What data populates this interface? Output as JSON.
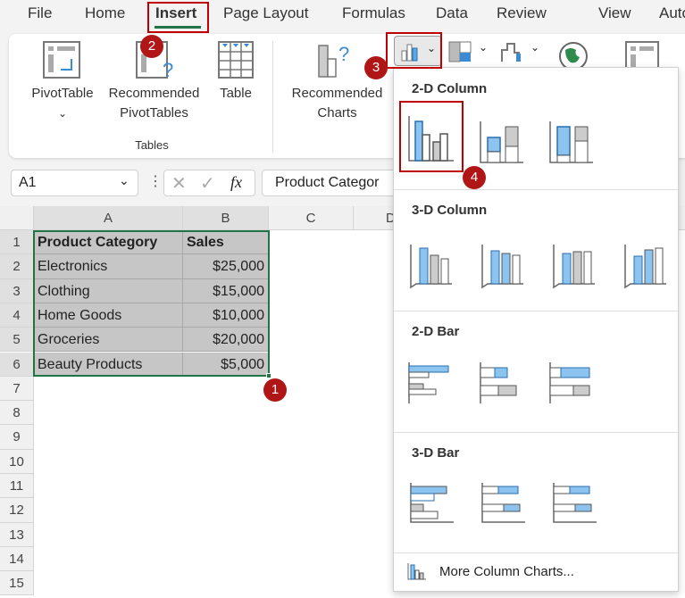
{
  "menu_tabs": [
    "File",
    "Home",
    "Insert",
    "Page Layout",
    "Formulas",
    "Data",
    "Review",
    "View",
    "Autom"
  ],
  "active_tab": "Insert",
  "ribbon": {
    "pivottable": "PivotTable",
    "rec_pivot_1": "Recommended",
    "rec_pivot_2": "PivotTables",
    "table": "Table",
    "group_tables": "Tables",
    "rec_charts_1": "Recommended",
    "rec_charts_2": "Charts"
  },
  "formula_bar": {
    "name_box": "A1",
    "fx": "fx",
    "content": "Product Categor"
  },
  "columns": [
    "A",
    "B",
    "C",
    "D"
  ],
  "rows": [
    "1",
    "2",
    "3",
    "4",
    "5",
    "6",
    "7",
    "8",
    "9",
    "10",
    "11",
    "12",
    "13",
    "14",
    "15"
  ],
  "table": {
    "headers": [
      "Product Category",
      "Sales"
    ],
    "data": [
      [
        "Electronics",
        "$25,000"
      ],
      [
        "Clothing",
        "$15,000"
      ],
      [
        "Home Goods",
        "$10,000"
      ],
      [
        "Groceries",
        "$20,000"
      ],
      [
        "Beauty Products",
        "$5,000"
      ]
    ]
  },
  "dropdown": {
    "sections": [
      "2-D Column",
      "3-D Column",
      "2-D Bar",
      "3-D Bar"
    ],
    "more": "More Column Charts..."
  },
  "badges": [
    "1",
    "2",
    "3",
    "4"
  ],
  "colors": {
    "accent_green": "#217346",
    "annotation_red": "#c00000",
    "chart_blue": "#5aa9e6"
  }
}
